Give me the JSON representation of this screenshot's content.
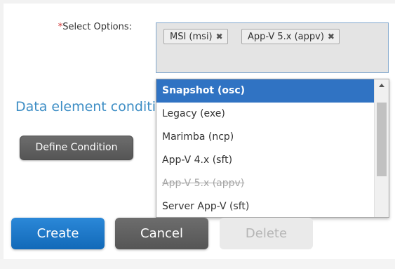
{
  "form": {
    "required_marker": "*",
    "select_label": "Select Options:"
  },
  "selected_chips": [
    {
      "label": "MSI (msi)",
      "remove_icon": "✖"
    },
    {
      "label": "App-V 5.x (appv)",
      "remove_icon": "✖"
    }
  ],
  "section_title": "Data element conditions",
  "define_condition_label": "Define Condition",
  "dropdown": {
    "options": [
      {
        "label": "Snapshot (osc)",
        "state": "highlighted"
      },
      {
        "label": "Legacy (exe)",
        "state": "normal"
      },
      {
        "label": "Marimba (ncp)",
        "state": "normal"
      },
      {
        "label": "App-V 4.x (sft)",
        "state": "normal"
      },
      {
        "label": "App-V 5.x (appv)",
        "state": "disabled"
      },
      {
        "label": "Server App-V (sft)",
        "state": "normal"
      }
    ]
  },
  "actions": {
    "create": "Create",
    "cancel": "Cancel",
    "delete": "Delete"
  },
  "colors": {
    "accent": "#3073c3",
    "title_blue": "#3e8ec5",
    "required": "#d03030",
    "dark_button": "#5f5f5f"
  },
  "icons": {
    "chip_remove": "close-icon",
    "scroll_up": "chevron-up-icon"
  }
}
